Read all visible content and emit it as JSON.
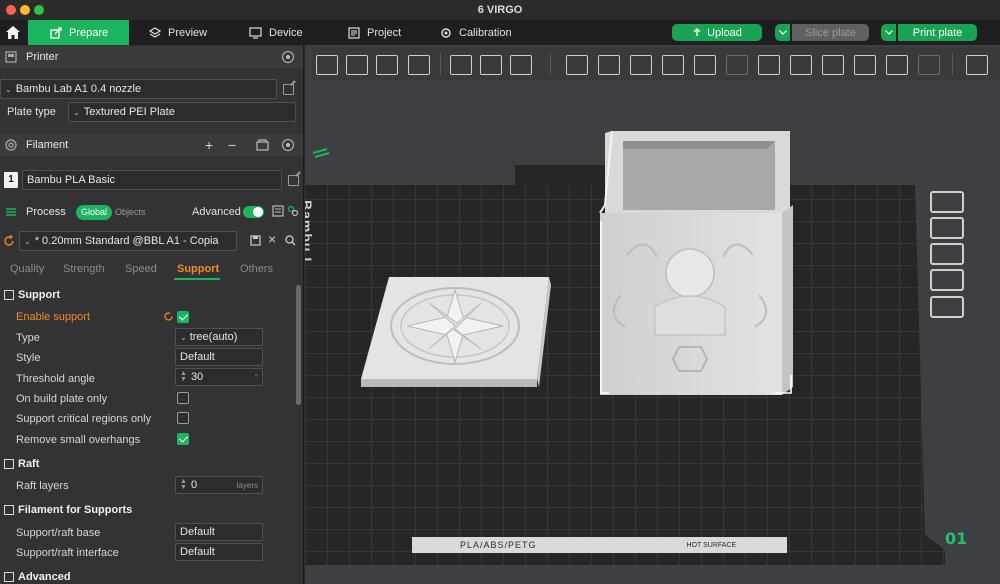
{
  "window": {
    "title": "6 VIRGO"
  },
  "tabs": [
    {
      "label": "Prepare"
    },
    {
      "label": "Preview"
    },
    {
      "label": "Device"
    },
    {
      "label": "Project"
    },
    {
      "label": "Calibration"
    }
  ],
  "actions": {
    "upload": "Upload",
    "slice": "Slice plate",
    "print": "Print plate"
  },
  "printer": {
    "heading": "Printer",
    "model": "Bambu Lab A1 0.4 nozzle",
    "plate_type_label": "Plate type",
    "plate_type": "Textured PEI Plate"
  },
  "filament": {
    "heading": "Filament",
    "slot": "1",
    "name": "Bambu PLA Basic"
  },
  "process": {
    "heading": "Process",
    "global": "Global",
    "objects": "Objects",
    "advanced": "Advanced",
    "preset": "* 0.20mm Standard @BBL A1 - Copia",
    "subtabs": [
      "Quality",
      "Strength",
      "Speed",
      "Support",
      "Others"
    ],
    "active_subtab": "Support"
  },
  "support": {
    "heading": "Support",
    "enable_support": "Enable support",
    "enable_support_on": true,
    "type_label": "Type",
    "type_value": "tree(auto)",
    "style_label": "Style",
    "style_value": "Default",
    "threshold_label": "Threshold angle",
    "threshold_value": "30",
    "threshold_unit": "°",
    "build_plate_only": "On build plate only",
    "build_plate_only_on": false,
    "critical_regions": "Support critical regions only",
    "critical_regions_on": false,
    "remove_overhangs": "Remove small overhangs",
    "remove_overhangs_on": true
  },
  "raft": {
    "heading": "Raft",
    "layers_label": "Raft layers",
    "layers_value": "0",
    "layers_unit": "layers"
  },
  "filament_supports": {
    "heading": "Filament for Supports",
    "base_label": "Support/raft base",
    "base_value": "Default",
    "interface_label": "Support/raft interface",
    "interface_value": "Default"
  },
  "advanced_section": {
    "heading": "Advanced"
  },
  "plate": {
    "label": "PLA/ABS/PETG",
    "surface": "HOT SURFACE",
    "number": "01",
    "logo_text": "Bambu L"
  },
  "colors": {
    "accent": "#1db45f",
    "orange": "#f08a24",
    "panel": "#333336",
    "viewport": "#3e3f42"
  }
}
